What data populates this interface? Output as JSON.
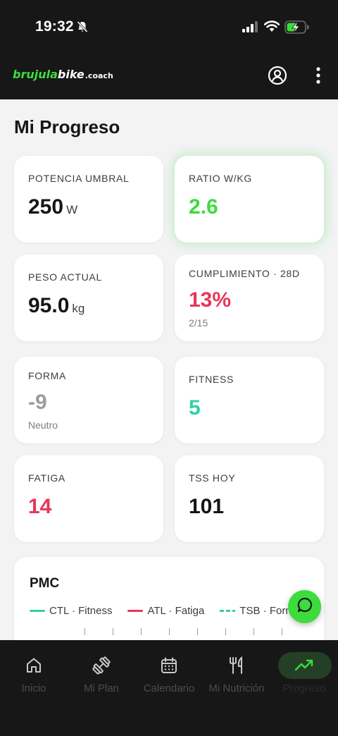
{
  "status_bar": {
    "time": "19:32",
    "icons": [
      "bell-slash-icon",
      "cellular-signal-icon",
      "wifi-icon",
      "battery-charging-icon"
    ]
  },
  "header": {
    "logo_part1": "brujula",
    "logo_part2": "bike",
    "logo_part3": ".coach",
    "icons": [
      "account-icon",
      "more-vertical-icon"
    ]
  },
  "page": {
    "title": "Mi Progreso"
  },
  "cards": {
    "potencia": {
      "label": "POTENCIA UMBRAL",
      "value": "250",
      "unit": "W"
    },
    "ratio": {
      "label": "RATIO W/KG",
      "value": "2.6"
    },
    "peso": {
      "label": "PESO ACTUAL",
      "value": "95.0",
      "unit": "kg"
    },
    "cumplimiento": {
      "label": "CUMPLIMIENTO · 28D",
      "value": "13%",
      "sub": "2/15"
    },
    "forma": {
      "label": "FORMA",
      "value": "-9",
      "sub": "Neutro"
    },
    "fitness": {
      "label": "FITNESS",
      "value": "5"
    },
    "fatiga": {
      "label": "FATIGA",
      "value": "14"
    },
    "tss": {
      "label": "TSS HOY",
      "value": "101"
    }
  },
  "pmc": {
    "title": "PMC",
    "legend": [
      {
        "label": "CTL · Fitness",
        "color": "#2fd1a6"
      },
      {
        "label": "ATL · Fatiga",
        "color": "#e8365a"
      },
      {
        "label": "TSB · Forma",
        "color": "#2fd1a6"
      }
    ]
  },
  "fab": {
    "icon": "chat-bubble-icon"
  },
  "bottom_nav": {
    "items": [
      {
        "label": "Inicio",
        "icon": "home-icon"
      },
      {
        "label": "Mi Plan",
        "icon": "dumbbell-icon"
      },
      {
        "label": "Calendario",
        "icon": "calendar-icon"
      },
      {
        "label": "Mi Nutrición",
        "icon": "fork-knife-icon"
      },
      {
        "label": "Progreso",
        "icon": "trending-up-icon"
      }
    ],
    "active": "Progreso"
  },
  "colors": {
    "brand_green": "#3ddc3d",
    "danger_red": "#e8365a",
    "fitness_teal": "#2fd1a6",
    "dark_bg": "#161716"
  }
}
